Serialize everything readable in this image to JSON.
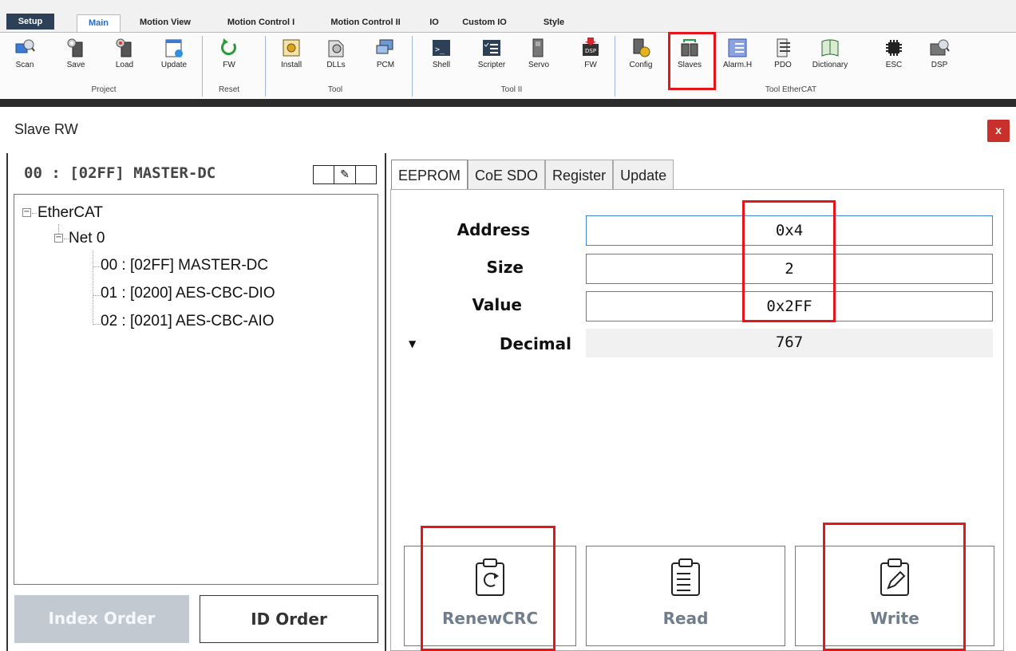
{
  "ribbon": {
    "tabs": [
      "Setup",
      "Main",
      "Motion View",
      "Motion Control I",
      "Motion Control II",
      "IO",
      "Custom IO",
      "Style"
    ],
    "groups": {
      "project": {
        "label": "Project",
        "buttons": [
          "Scan",
          "Save",
          "Load",
          "Update"
        ]
      },
      "reset": {
        "label": "Reset",
        "buttons": [
          "FW"
        ]
      },
      "tool": {
        "label": "Tool",
        "buttons": [
          "Install",
          "DLLs",
          "PCM"
        ]
      },
      "tool2": {
        "label": "Tool II",
        "buttons": [
          "Shell",
          "Scripter",
          "Servo",
          "FW"
        ]
      },
      "ethercat": {
        "label": "Tool EtherCAT",
        "buttons": [
          "Config",
          "Slaves",
          "Alarm.H",
          "PDO",
          "Dictionary",
          "ESC",
          "DSP"
        ]
      }
    }
  },
  "window": {
    "title": "Slave RW",
    "close_label": "x",
    "slave_header": "00 : [02FF] MASTER-DC",
    "tree": {
      "root": "EtherCAT",
      "net": "Net 0",
      "slaves": [
        "00 : [02FF] MASTER-DC",
        "01 : [0200] AES-CBC-DIO",
        "02 : [0201] AES-CBC-AIO"
      ]
    },
    "order_buttons": {
      "index": "Index Order",
      "id": "ID Order"
    },
    "tabs": [
      "EEPROM",
      "CoE SDO",
      "Register",
      "Update"
    ],
    "fields": {
      "address": {
        "label": "Address",
        "value": "0x4"
      },
      "size": {
        "label": "Size",
        "value": "2"
      },
      "value": {
        "label": "Value",
        "value": "0x2FF"
      },
      "decimal": {
        "label": "Decimal",
        "value": "767"
      }
    },
    "actions": {
      "renew": "RenewCRC",
      "read": "Read",
      "write": "Write"
    }
  },
  "colors": {
    "highlight": "#e8141c",
    "setup_tab": "#2e3f58",
    "close_button": "#c9302c",
    "accent": "#2a6dc0"
  }
}
